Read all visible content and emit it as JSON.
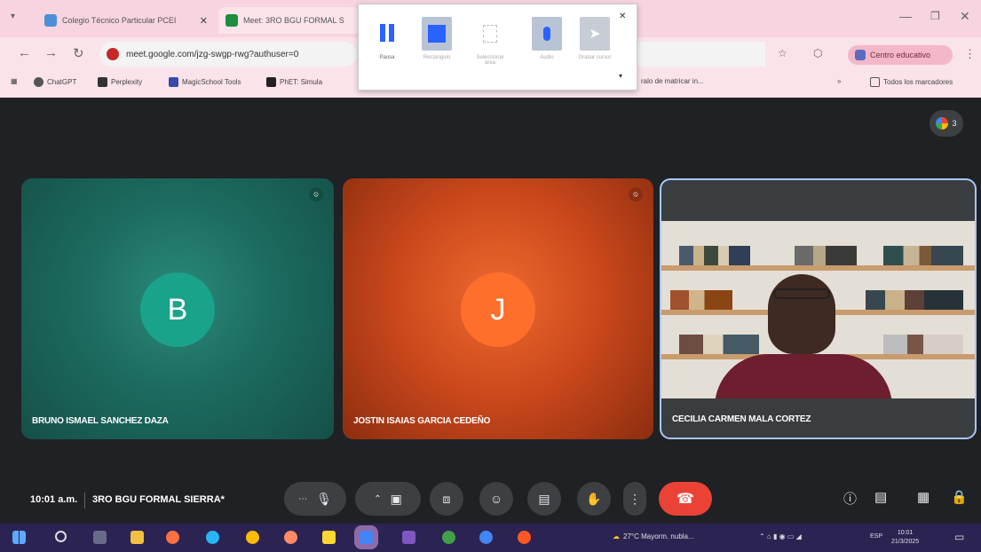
{
  "browser": {
    "tabs": [
      {
        "title": "Colegio Técnico Particular PCEI",
        "active": false
      },
      {
        "title": "Meet: 3RO BGU FORMAL S",
        "active": true
      }
    ],
    "url": "meet.google.com/jzg-swgp-rwg?authuser=0",
    "url_right_fragment": "ralo de matricar in...",
    "profile_label": "Centro educativo",
    "bookmarks": [
      "ChatGPT",
      "Perplexity",
      "MagicSchool Tools",
      "PhET: Simula"
    ],
    "other_bookmarks": "Todos los marcadores",
    "colors": {
      "tabstrip": "#f7d4df",
      "toolbar": "#fbe3ea",
      "profile": "#f2b7c8"
    }
  },
  "recorder": {
    "buttons": [
      {
        "label": "Pausa",
        "icon": "pause-icon"
      },
      {
        "label": "Rectángulo",
        "icon": "rectangle-icon"
      },
      {
        "label": "Seleccionar área",
        "icon": "area-icon"
      },
      {
        "label": "Audio",
        "icon": "microphone-icon"
      },
      {
        "label": "Grabar cursor",
        "icon": "cursor-icon"
      }
    ]
  },
  "meet": {
    "participant_count": "3",
    "tiles": [
      {
        "initial": "B",
        "name": "BRUNO ISMAEL SANCHEZ DAZA",
        "color": "#1aa38b"
      },
      {
        "initial": "J",
        "name": "JOSTIN ISAIAS GARCIA CEDEÑO",
        "color": "#ff6f2c"
      },
      {
        "initial": "",
        "name": "CECILIA CARMEN MALA CORTEZ",
        "color": "#a8c7fa"
      }
    ],
    "time": "10:01 a.m.",
    "meeting_title": "3RO BGU FORMAL SIERRA*",
    "hangup_color": "#ea4335"
  },
  "taskbar": {
    "weather": "27°C Mayorm. nubla...",
    "time": "10:01",
    "date": "21/3/2025",
    "lang": "ESP"
  }
}
